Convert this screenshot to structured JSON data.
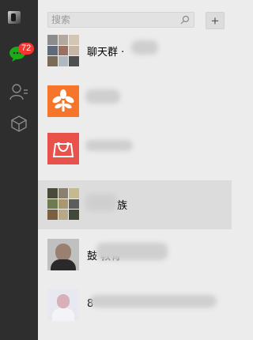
{
  "sidebar": {
    "unread_badge": "72",
    "items": [
      {
        "icon": "chat-icon",
        "active": true
      },
      {
        "icon": "contacts-icon",
        "active": false
      },
      {
        "icon": "cube-icon",
        "active": false
      }
    ]
  },
  "search": {
    "placeholder": "搜索",
    "add_label": "+"
  },
  "chats": [
    {
      "name": "聊天群 ·"
    },
    {
      "name": ""
    },
    {
      "name": ""
    },
    {
      "name": "族"
    },
    {
      "name": "鼓                     教育"
    },
    {
      "name": "                                      8"
    }
  ],
  "colors": {
    "rail": "#2e2e2e",
    "panel": "#ececec",
    "selected": "#dcdcdc",
    "badge": "#f43530",
    "active_icon": "#1aad19",
    "orange_tile": "#f5762a",
    "red_tile": "#e8524a"
  }
}
